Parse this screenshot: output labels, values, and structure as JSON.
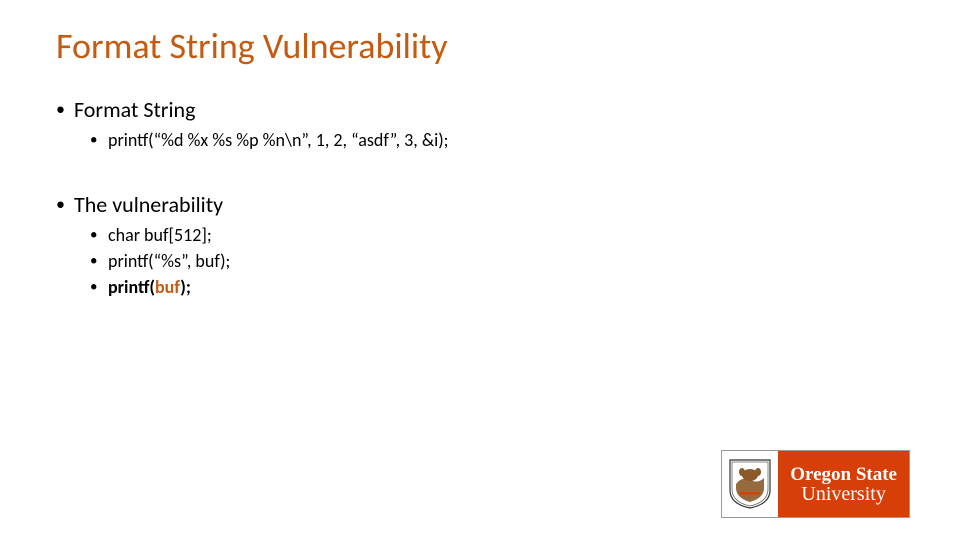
{
  "title": "Format String Vulnerability",
  "sections": [
    {
      "heading": "Format String",
      "items": [
        {
          "text": "printf(“%d %x %s %p %n\\n”, 1, 2, “asdf”, 3, &i);"
        }
      ]
    },
    {
      "heading": "The vulnerability",
      "items": [
        {
          "text": "char buf[512];"
        },
        {
          "text": "printf(“%s”, buf);"
        },
        {
          "prefix": "printf(",
          "emph": "buf",
          "suffix": ");",
          "bold_all": true,
          "emph_color": true
        }
      ]
    }
  ],
  "logo": {
    "line1": "Oregon State",
    "line2": "University"
  }
}
